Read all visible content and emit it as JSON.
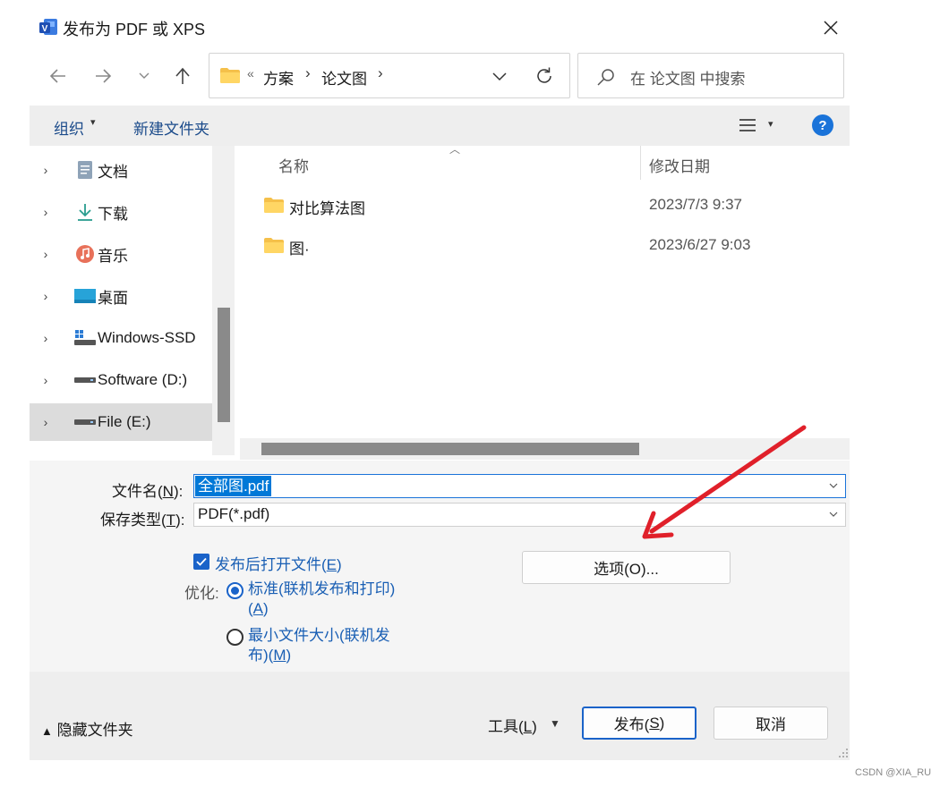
{
  "window": {
    "title": "发布为 PDF 或 XPS",
    "icon": "visio-app-icon"
  },
  "nav": {
    "back": "back-arrow-icon",
    "forward": "forward-arrow-icon",
    "recent": "chevron-down-icon",
    "up": "up-arrow-icon",
    "address": {
      "more": "«",
      "crumbs": [
        "方案",
        "论文图"
      ],
      "separator": "›"
    },
    "search_placeholder": "在 论文图 中搜索"
  },
  "toolbar": {
    "organize": "组织",
    "new_folder": "新建文件夹"
  },
  "sidebar": {
    "items": [
      {
        "label": "文档",
        "icon": "documents-icon"
      },
      {
        "label": "下载",
        "icon": "downloads-icon"
      },
      {
        "label": "音乐",
        "icon": "music-icon"
      },
      {
        "label": "桌面",
        "icon": "desktop-icon"
      },
      {
        "label": "Windows-SSD",
        "icon": "windows-drive-icon"
      },
      {
        "label": "Software (D:)",
        "icon": "drive-icon"
      },
      {
        "label": "File (E:)",
        "icon": "drive-icon",
        "selected": true
      }
    ]
  },
  "file_list": {
    "columns": [
      "名称",
      "修改日期"
    ],
    "rows": [
      {
        "name": "对比算法图",
        "date": "2023/7/3 9:37",
        "icon": "folder-icon"
      },
      {
        "name": "图·",
        "date": "2023/6/27 9:03",
        "icon": "folder-icon"
      }
    ]
  },
  "form": {
    "filename_label": "文件名(",
    "filename_key": "N",
    "filename_label_end": "):",
    "filename_value": "全部图.pdf",
    "filetype_label": "保存类型(",
    "filetype_key": "T",
    "filetype_label_end": "):",
    "filetype_value": "PDF(*.pdf)",
    "open_after_publish": {
      "label": "发布后打开文件(",
      "key": "E",
      "end": ")",
      "checked": true
    },
    "optimize_label": "优化:",
    "optimize_options": [
      {
        "line1": "标准(联机发布和打印)",
        "line2a": "(",
        "key": "A",
        "line2b": ")",
        "selected": true
      },
      {
        "line1": "最小文件大小(联机发",
        "line2a": "布)(",
        "key": "M",
        "line2b": ")",
        "selected": false
      }
    ],
    "options_button": "选项(O)..."
  },
  "footer": {
    "hide_folders": "隐藏文件夹",
    "tools_label": "工具(",
    "tools_key": "L",
    "tools_end": ")",
    "publish_label": "发布(",
    "publish_key": "S",
    "publish_end": ")",
    "cancel_label": "取消"
  },
  "watermark": "CSDN @XIA_RU",
  "colors": {
    "accent": "#1a63c9",
    "annotation_arrow": "#e0202a"
  }
}
